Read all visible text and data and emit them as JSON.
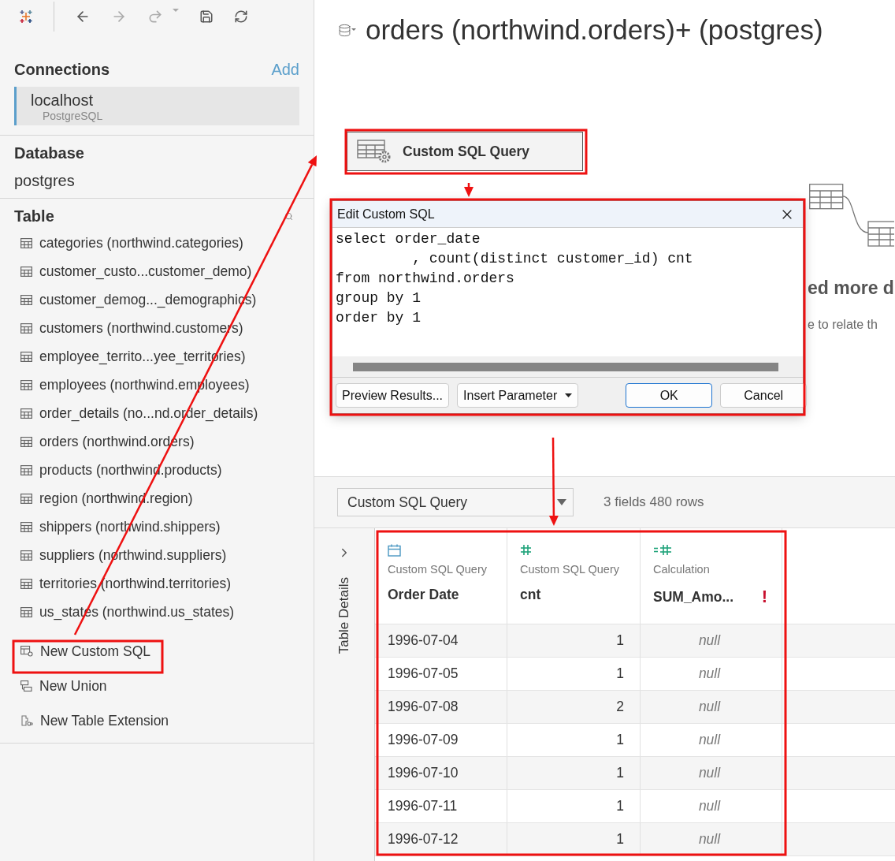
{
  "connections": {
    "heading": "Connections",
    "add": "Add",
    "items": [
      {
        "name": "localhost",
        "type": "PostgreSQL",
        "selected": true
      }
    ]
  },
  "database": {
    "heading": "Database",
    "value": "postgres"
  },
  "table_section": {
    "heading": "Table",
    "tables": [
      "categories (northwind.categories)",
      "customer_custo...customer_demo)",
      "customer_demog..._demographics)",
      "customers (northwind.customers)",
      "employee_territo...yee_territories)",
      "employees (northwind.employees)",
      "order_details (no...nd.order_details)",
      "orders (northwind.orders)",
      "products (northwind.products)",
      "region (northwind.region)",
      "shippers (northwind.shippers)",
      "suppliers (northwind.suppliers)",
      "territories (northwind.territories)",
      "us_states (northwind.us_states)"
    ],
    "actions": [
      {
        "label": "New Custom SQL",
        "kind": "custom_sql"
      },
      {
        "label": "New Union",
        "kind": "union"
      },
      {
        "label": "New Table Extension",
        "kind": "extension"
      }
    ]
  },
  "canvas": {
    "title": "orders (northwind.orders)+ (postgres)",
    "node": "Custom SQL Query",
    "hint_title": "ed more d",
    "hint_text": "e to relate th"
  },
  "dialog": {
    "title": "Edit Custom SQL",
    "sql": [
      "select order_date",
      "         , count(distinct customer_id) cnt",
      "from northwind.orders",
      "group by 1",
      "order by 1"
    ],
    "buttons": [
      {
        "label": "Preview Results...",
        "kind": "plain"
      },
      {
        "label": "Insert Parameter",
        "kind": "menu"
      },
      {
        "label": "OK",
        "kind": "default"
      },
      {
        "label": "Cancel",
        "kind": "plain"
      }
    ]
  },
  "data_pane": {
    "source_select": "Custom SQL Query",
    "summary": "3 fields 480 rows",
    "side_tab": "Table Details",
    "columns": [
      {
        "source": "Custom SQL Query",
        "name": "Order Date",
        "kind": "date"
      },
      {
        "source": "Custom SQL Query",
        "name": "cnt",
        "kind": "number"
      },
      {
        "source": "Calculation",
        "name": "SUM_Amo...",
        "kind": "calc",
        "warning": "!"
      }
    ],
    "rows": [
      [
        "1996-07-04",
        "1",
        "null"
      ],
      [
        "1996-07-05",
        "1",
        "null"
      ],
      [
        "1996-07-08",
        "2",
        "null"
      ],
      [
        "1996-07-09",
        "1",
        "null"
      ],
      [
        "1996-07-10",
        "1",
        "null"
      ],
      [
        "1996-07-11",
        "1",
        "null"
      ],
      [
        "1996-07-12",
        "1",
        "null"
      ]
    ]
  }
}
